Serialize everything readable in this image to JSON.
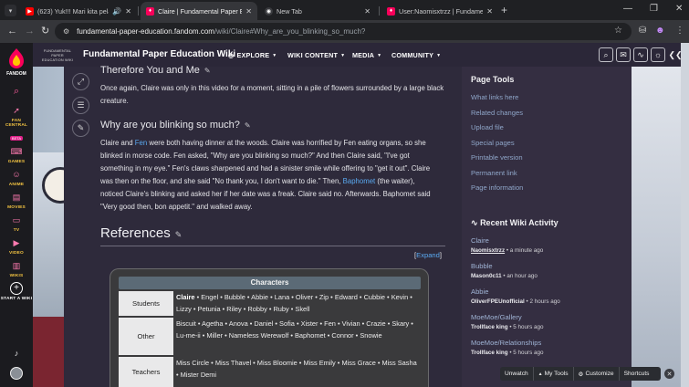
{
  "browser": {
    "tabs": [
      {
        "title": "(623) Yuk!!! Mari kita pelaja",
        "favicon": "youtube-icon",
        "audio": true,
        "active": false
      },
      {
        "title": "Claire | Fundamental Paper Edu",
        "favicon": "fandom-icon",
        "active": true
      },
      {
        "title": "New Tab",
        "favicon": "chrome-icon",
        "active": false
      },
      {
        "title": "User:Naomisxtrzz | Fundamentu",
        "favicon": "fandom-icon",
        "active": false
      }
    ],
    "url_host": "fundamental-paper-education.fandom.com",
    "url_path": "/wiki/Claire#Why_are_you_blinking_so_much?"
  },
  "fandom_nav": {
    "logo_text": "FANDOM",
    "items": [
      {
        "label": "",
        "icon": "search-icon"
      },
      {
        "label": "FAN CENTRAL",
        "icon": "rocket-icon",
        "badge": "BETA"
      },
      {
        "label": "GAMES",
        "icon": "gamepad-icon"
      },
      {
        "label": "ANIME",
        "icon": "anime-icon"
      },
      {
        "label": "MOVIES",
        "icon": "clapper-icon"
      },
      {
        "label": "TV",
        "icon": "tv-icon"
      },
      {
        "label": "VIDEO",
        "icon": "play-icon"
      },
      {
        "label": "WIKIS",
        "icon": "book-icon"
      },
      {
        "label": "START A WIKI",
        "icon": "plus-circle-icon"
      }
    ]
  },
  "wiki": {
    "logo_text": "FUNDAMENTAL PAPER EDUCATION WIKI",
    "name": "Fundamental Paper Education Wiki",
    "menus": [
      "EXPLORE",
      "WIKI CONTENT",
      "MEDIA",
      "COMMUNITY"
    ]
  },
  "article": {
    "section1_heading": "Therefore You and Me",
    "section1_text": "Once again, Claire was only in this video for a moment, sitting in a pile of flowers surrounded by a large black creature.",
    "section2_heading": "Why are you blinking so much?",
    "section2_lines": [
      [
        "Claire and ",
        "Fen",
        " were both having dinner at the woods. Claire was horrified by Fen eating organs, so she"
      ],
      [
        "blinked in morse code. Fen asked, \"Why are you blinking so much?\" And then Claire said, \"I've got",
        "",
        ""
      ],
      [
        "something in my eye.\" Fen's claws sharpened and had a sinister smile while offering to \"get it out\". Claire",
        "",
        ""
      ],
      [
        "was then on the floor, and she said \"No thank you, I don't want to die.\" Then, ",
        "Baphomet",
        " (the waiter),"
      ],
      [
        "noticed Claire's blinking and asked her if her date was a freak. Claire said no. Afterwards. Baphomet said",
        "",
        ""
      ],
      [
        "\"Very good then, bon appetit.\" and walked away.",
        "",
        ""
      ]
    ],
    "references_heading": "References",
    "expand_open": "[",
    "expand_label": "Expand",
    "expand_close": "]"
  },
  "navbox": {
    "title": "Characters",
    "groups": [
      {
        "name": "Students",
        "first": "Claire",
        "rest": " • Engel • Bubble • Abbie • Lana • Oliver • Zip • Edward • Cubbie • Kevin • Lizzy • Petunia • Riley • Robby • Ruby • Skell"
      },
      {
        "name": "Other",
        "first": "",
        "rest": "Biscuit • Agetha • Anova • Daniel • Sofia • Xister • Fen • Vivian • Crazie • Skary • Lu-me-ii • Miller • Nameless Werewolf • Baphomet • Connor • Snowie"
      },
      {
        "name": "Teachers",
        "first": "",
        "rest": "Miss Circle • Miss Thavel • Miss Bloomie • Miss Emily • Miss Grace • Miss Sasha • Mister Demi"
      }
    ]
  },
  "rail": {
    "page_tools_heading": "Page Tools",
    "page_tools": [
      "What links here",
      "Related changes",
      "Upload file",
      "Special pages",
      "Printable version",
      "Permanent link",
      "Page information"
    ],
    "activity_heading": "Recent Wiki Activity",
    "activity": [
      {
        "title": "Claire",
        "user": "Naomisxtrzz",
        "time": " • a minute ago"
      },
      {
        "title": "Bubble",
        "user": "Mason0c11",
        "time": " • an hour ago"
      },
      {
        "title": "Abbie",
        "user": "OliverFPEUnofficial",
        "time": " • 2 hours ago"
      },
      {
        "title": "MoeMoe/Gallery",
        "user": "Trollface king",
        "time": " • 5 hours ago"
      },
      {
        "title": "MoeMoe/Relationships",
        "user": "Trollface king",
        "time": " • 5 hours ago"
      }
    ]
  },
  "bottom_bar": {
    "unwatch": "Unwatch",
    "my_tools": "My Tools",
    "customize": "Customize",
    "shortcuts": "Shortcuts"
  },
  "colors": {
    "link": "#5aa9f0",
    "fandom_accent": "#f5c542",
    "header_bg": "#2b2738",
    "content_bg": "#2e2a3b"
  }
}
